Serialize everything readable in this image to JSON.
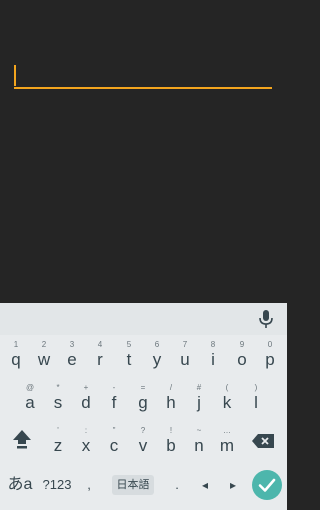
{
  "input": {
    "value": ""
  },
  "keyboard": {
    "row1": [
      {
        "hint": "1",
        "key": "q"
      },
      {
        "hint": "2",
        "key": "w"
      },
      {
        "hint": "3",
        "key": "e"
      },
      {
        "hint": "4",
        "key": "r"
      },
      {
        "hint": "5",
        "key": "t"
      },
      {
        "hint": "6",
        "key": "y"
      },
      {
        "hint": "7",
        "key": "u"
      },
      {
        "hint": "8",
        "key": "i"
      },
      {
        "hint": "9",
        "key": "o"
      },
      {
        "hint": "0",
        "key": "p"
      }
    ],
    "row2": [
      {
        "hint": "@",
        "key": "a"
      },
      {
        "hint": "*",
        "key": "s"
      },
      {
        "hint": "+",
        "key": "d"
      },
      {
        "hint": "-",
        "key": "f"
      },
      {
        "hint": "=",
        "key": "g"
      },
      {
        "hint": "/",
        "key": "h"
      },
      {
        "hint": "#",
        "key": "j"
      },
      {
        "hint": "(",
        "key": "k"
      },
      {
        "hint": ")",
        "key": "l"
      }
    ],
    "row3": [
      {
        "hint": "'",
        "key": "z"
      },
      {
        "hint": ":",
        "key": "x"
      },
      {
        "hint": "\"",
        "key": "c"
      },
      {
        "hint": "?",
        "key": "v"
      },
      {
        "hint": "!",
        "key": "b"
      },
      {
        "hint": "~",
        "key": "n"
      },
      {
        "hint": "…",
        "key": "m"
      }
    ],
    "bottom": {
      "kana_switch": "あa",
      "symbols": "?123",
      "comma": ",",
      "language": "日本語",
      "period": ".",
      "left_arrow": "◂",
      "right_arrow": "▸"
    },
    "icons": {
      "mic": "mic-icon",
      "shift": "shift-icon",
      "backspace": "backspace-icon",
      "enter": "check-icon"
    },
    "colors": {
      "accent": "#F3A51E",
      "enter": "#4DB6AC"
    }
  }
}
